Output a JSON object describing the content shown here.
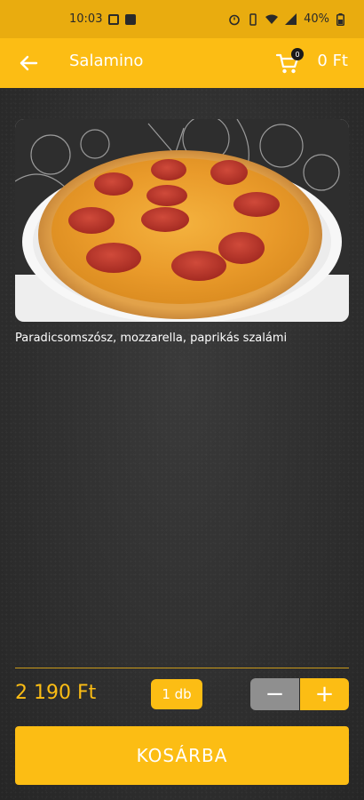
{
  "status_bar": {
    "time": "10:03",
    "battery": "40%"
  },
  "app_bar": {
    "title": "Salamino",
    "cart_count": "0",
    "cart_total": "0 Ft"
  },
  "product": {
    "description": "Paradicsomszósz, mozzarella, paprikás szalámi",
    "price": "2 190 Ft",
    "quantity": "1 db",
    "add_to_cart_label": "KOSÁRBA"
  },
  "stepper": {
    "minus_label": "−",
    "plus_label": "+"
  },
  "icons": {
    "back": "arrow-back-icon",
    "cart": "cart-icon"
  },
  "colors": {
    "accent": "#fcbd14",
    "status_bar": "#e9ac0f",
    "background": "#2b2b2b",
    "stepper_disabled": "#8f8f8f"
  }
}
